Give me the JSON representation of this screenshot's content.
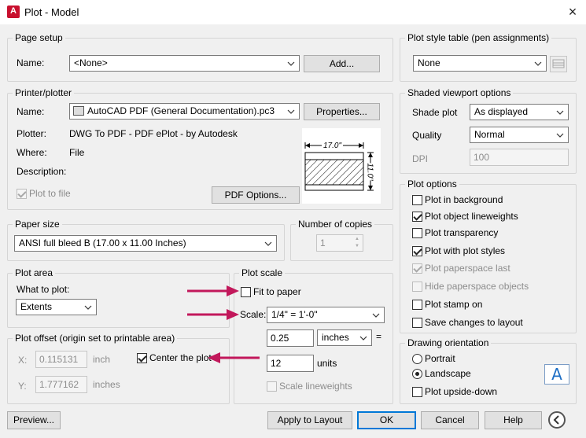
{
  "window": {
    "title": "Plot - Model",
    "close_icon": "×"
  },
  "page_setup": {
    "legend": "Page setup",
    "name_label": "Name:",
    "name_value": "<None>",
    "add_button": "Add..."
  },
  "printer": {
    "legend": "Printer/plotter",
    "name_label": "Name:",
    "name_value": "AutoCAD PDF (General Documentation).pc3",
    "properties_button": "Properties...",
    "plotter_label": "Plotter:",
    "plotter_value": "DWG To PDF - PDF ePlot - by Autodesk",
    "where_label": "Where:",
    "where_value": "File",
    "description_label": "Description:",
    "plot_to_file_label": "Plot to file",
    "pdf_options_button": "PDF Options...",
    "preview_width": "17.0\"",
    "preview_height": "11.0\""
  },
  "paper_size": {
    "legend": "Paper size",
    "value": "ANSI full bleed B (17.00 x 11.00 Inches)"
  },
  "copies": {
    "legend": "Number of copies",
    "value": "1"
  },
  "plot_area": {
    "legend": "Plot area",
    "what_label": "What to plot:",
    "what_value": "Extents"
  },
  "plot_offset": {
    "legend": "Plot offset (origin set to printable area)",
    "x_label": "X:",
    "x_value": "0.115131",
    "x_unit": "inch",
    "y_label": "Y:",
    "y_value": "1.777162",
    "y_unit": "inches",
    "center_label": "Center the plot"
  },
  "plot_scale": {
    "legend": "Plot scale",
    "fit_label": "Fit to paper",
    "scale_label": "Scale:",
    "scale_value": "1/4\" = 1'-0\"",
    "value1": "0.25",
    "unit1": "inches",
    "equals": "=",
    "value2": "12",
    "unit2": "units",
    "lineweights_label": "Scale lineweights"
  },
  "plot_style": {
    "legend": "Plot style table (pen assignments)",
    "value": "None"
  },
  "shaded": {
    "legend": "Shaded viewport options",
    "shade_label": "Shade plot",
    "shade_value": "As displayed",
    "quality_label": "Quality",
    "quality_value": "Normal",
    "dpi_label": "DPI",
    "dpi_value": "100"
  },
  "plot_options": {
    "legend": "Plot options",
    "items": [
      {
        "label": "Plot in background",
        "checked": false,
        "disabled": false
      },
      {
        "label": "Plot object lineweights",
        "checked": true,
        "disabled": false
      },
      {
        "label": "Plot transparency",
        "checked": false,
        "disabled": false
      },
      {
        "label": "Plot with plot styles",
        "checked": true,
        "disabled": false
      },
      {
        "label": "Plot paperspace last",
        "checked": true,
        "disabled": true
      },
      {
        "label": "Hide paperspace objects",
        "checked": false,
        "disabled": true
      },
      {
        "label": "Plot stamp on",
        "checked": false,
        "disabled": false
      },
      {
        "label": "Save changes to layout",
        "checked": false,
        "disabled": false
      }
    ]
  },
  "orientation": {
    "legend": "Drawing orientation",
    "portrait": "Portrait",
    "landscape": "Landscape",
    "upside_down": "Plot upside-down",
    "icon_letter": "A"
  },
  "footer": {
    "preview": "Preview...",
    "apply": "Apply to Layout",
    "ok": "OK",
    "cancel": "Cancel",
    "help": "Help"
  },
  "colors": {
    "arrow": "#c2185b",
    "accent": "#0078d7",
    "autocad_red": "#c8102e"
  }
}
